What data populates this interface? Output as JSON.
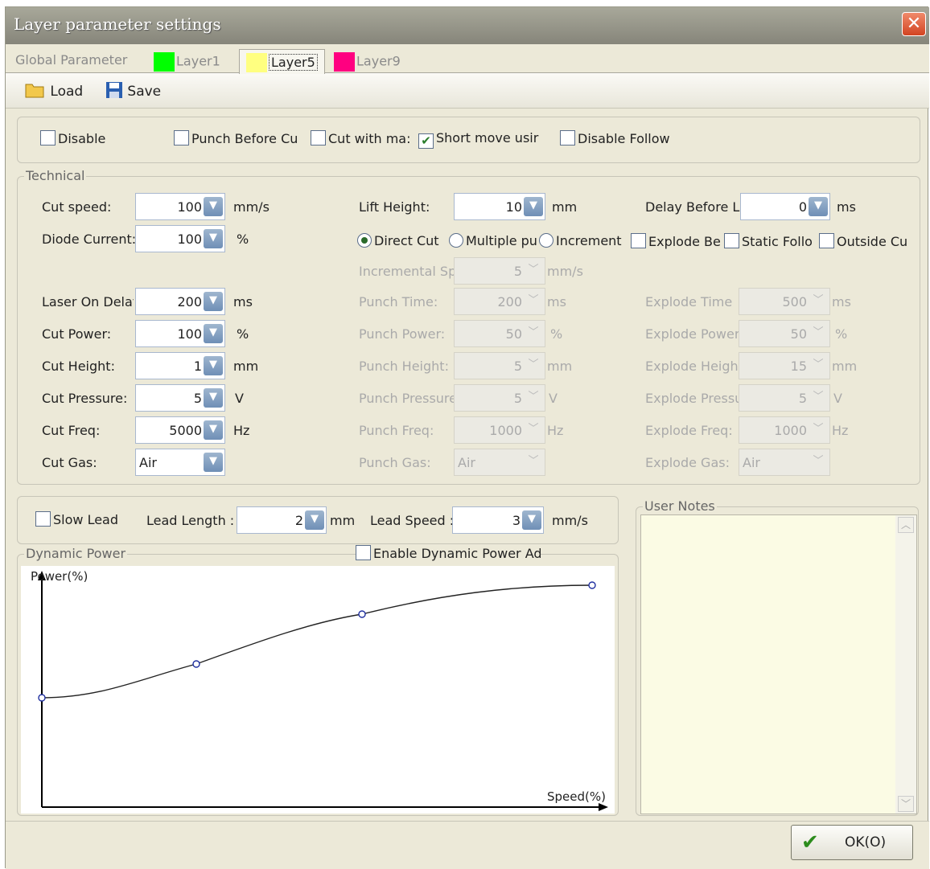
{
  "window": {
    "title": "Layer parameter settings"
  },
  "tabs": [
    {
      "label": "Global Parameter",
      "color": null
    },
    {
      "label": "Layer1",
      "color": "#00ff00"
    },
    {
      "label": "Layer5",
      "color": "#ffff80"
    },
    {
      "label": "Layer9",
      "color": "#ff0080"
    }
  ],
  "toolbar": {
    "load": "Load",
    "save": "Save"
  },
  "options": [
    {
      "label": "Disable",
      "checked": false
    },
    {
      "label": "Punch Before Cu",
      "checked": false
    },
    {
      "label": "Cut with ma:",
      "checked": false
    },
    {
      "label": "Short move usir",
      "checked": true
    },
    {
      "label": "Disable Follow",
      "checked": false
    }
  ],
  "technical": {
    "title": "Technical",
    "left": [
      {
        "label": "Cut speed:",
        "value": "100",
        "unit": "mm/s"
      },
      {
        "label": "Diode Current:",
        "value": "100",
        "unit": "%"
      },
      {
        "label": "Laser On Delay",
        "value": "200",
        "unit": "ms"
      },
      {
        "label": "Cut Power:",
        "value": "100",
        "unit": "%"
      },
      {
        "label": "Cut Height:",
        "value": "1",
        "unit": "mm"
      },
      {
        "label": "Cut Pressure:",
        "value": "5",
        "unit": "V"
      },
      {
        "label": "Cut Freq:",
        "value": "5000",
        "unit": "Hz"
      },
      {
        "label": "Cut Gas:",
        "value": "Air",
        "unit": ""
      }
    ],
    "lift": {
      "label": "Lift Height:",
      "value": "10",
      "unit": "mm"
    },
    "delay": {
      "label": "Delay Before L",
      "value": "0",
      "unit": "ms"
    },
    "mode": [
      {
        "label": "Direct Cut",
        "selected": true
      },
      {
        "label": "Multiple pu",
        "selected": false
      },
      {
        "label": "Increment",
        "selected": false
      }
    ],
    "checks": [
      {
        "label": "Explode Be",
        "checked": false
      },
      {
        "label": "Static Follo",
        "checked": false
      },
      {
        "label": "Outside Cu",
        "checked": false
      }
    ],
    "incremental": {
      "label": "Incremental Sp",
      "value": "5",
      "unit": "mm/s"
    },
    "punch": [
      {
        "label": "Punch Time:",
        "value": "200",
        "unit": "ms"
      },
      {
        "label": "Punch Power:",
        "value": "50",
        "unit": "%"
      },
      {
        "label": "Punch Height:",
        "value": "5",
        "unit": "mm"
      },
      {
        "label": "Punch Pressure",
        "value": "5",
        "unit": "V"
      },
      {
        "label": "Punch Freq:",
        "value": "1000",
        "unit": "Hz"
      },
      {
        "label": "Punch Gas:",
        "value": "Air",
        "unit": ""
      }
    ],
    "explode": [
      {
        "label": "Explode Time",
        "value": "500",
        "unit": "ms"
      },
      {
        "label": "Explode Power",
        "value": "50",
        "unit": "%"
      },
      {
        "label": "Explode Height",
        "value": "15",
        "unit": "mm"
      },
      {
        "label": "Explode Pressu",
        "value": "5",
        "unit": "V"
      },
      {
        "label": "Explode Freq:",
        "value": "1000",
        "unit": "Hz"
      },
      {
        "label": "Explode Gas:",
        "value": "Air",
        "unit": ""
      }
    ]
  },
  "lead": {
    "slow": "Slow Lead",
    "length_label": "Lead Length :",
    "length_value": "2",
    "length_unit": "mm",
    "speed_label": "Lead Speed :",
    "speed_value": "3",
    "speed_unit": "mm/s"
  },
  "dynamic": {
    "title": "Dynamic Power",
    "enable": "Enable Dynamic Power Ad",
    "enabled": false,
    "y_label": "Power(%)",
    "x_label": "Speed(%)"
  },
  "notes": {
    "title": "User Notes",
    "text": ""
  },
  "footer": {
    "ok": "OK(O)"
  }
}
